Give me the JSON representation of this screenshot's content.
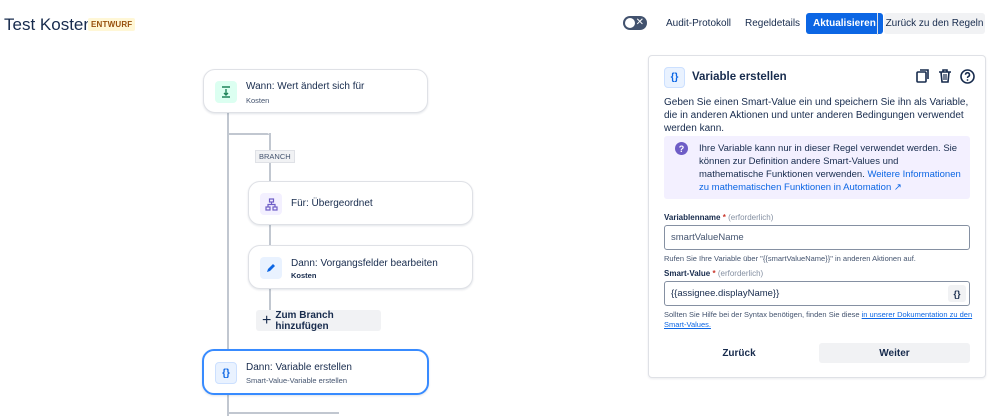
{
  "header": {
    "title": "Test Kosten",
    "status_badge": "ENTWURF",
    "toggle_symbol": "✕",
    "buttons": {
      "audit": "Audit-Protokoll",
      "rule_details": "Regeldetails",
      "update": "Aktualisieren",
      "back_to_rules": "Zurück zu den Regeln"
    }
  },
  "flow": {
    "trigger": {
      "title": "Wann: Wert ändert sich für",
      "subtitle": "Kosten",
      "icon": "trigger-icon"
    },
    "branch_tag": "BRANCH",
    "branch_for": {
      "title": "Für: Übergeordnet",
      "icon": "hierarchy-icon"
    },
    "edit_fields": {
      "title": "Dann: Vorgangsfelder bearbeiten",
      "subtitle": "Kosten",
      "icon": "pencil-icon"
    },
    "add_branch": {
      "symbol": "+",
      "label": "Zum Branch hinzufügen"
    },
    "create_variable": {
      "title": "Dann: Variable erstellen",
      "subtitle": "Smart-Value-Variable erstellen",
      "icon": "curly-braces-icon"
    }
  },
  "panel": {
    "icon_text": "{}",
    "title": "Variable erstellen",
    "description": "Geben Sie einen Smart-Value ein und speichern Sie ihn als Variable, die in anderen Aktionen und unter anderen Bedingungen verwendet werden kann.",
    "info_text": "Ihre Variable kann nur in dieser Regel verwendet werden. Sie können zur Definition andere Smart-Values und mathematische Funktionen verwenden.",
    "info_link": "Weitere Informationen zu mathematischen Funktionen in Automation ↗",
    "variable_name": {
      "label": "Variablenname",
      "required_mark": "*",
      "optional_hint": "(erforderlich)",
      "placeholder": "smartValueName",
      "help": "Rufen Sie Ihre Variable über \"{{smartValueName}}\" in anderen Aktionen auf."
    },
    "smart_value": {
      "label": "Smart-Value",
      "required_mark": "*",
      "optional_hint": "(erforderlich)",
      "value": "{{assignee.displayName}}",
      "button_text": "{}",
      "help_prefix": "Sollten Sie Hilfe bei der Syntax benötigen, finden Sie diese",
      "help_link": "in unserer Dokumentation zu den Smart-Values."
    },
    "back_button": "Zurück",
    "next_button": "Weiter"
  }
}
